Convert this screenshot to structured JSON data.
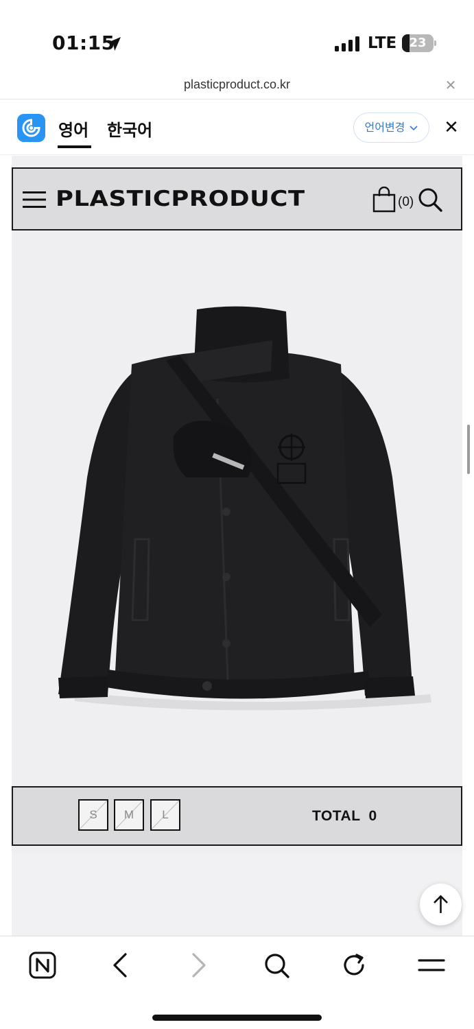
{
  "status_bar": {
    "time": "01:15",
    "network": "LTE",
    "battery_level": "23",
    "battery_fraction": 0.23
  },
  "browser": {
    "url": "plasticproduct.co.kr"
  },
  "translate_bar": {
    "tabs": [
      "영어",
      "한국어"
    ],
    "active_tab": "영어",
    "change_language_label": "언어변경",
    "brand_color": "#2a94f4"
  },
  "site": {
    "logo": "PLASTICPRODUCT",
    "cart_count": "(0)",
    "sizes": [
      "S",
      "M",
      "L"
    ],
    "total_label": "TOTAL",
    "total_value": "0"
  },
  "icons": {
    "status": [
      "location-arrow-icon",
      "signal-bars-icon",
      "battery-icon"
    ],
    "header": [
      "hamburger-menu-icon",
      "shopping-bag-icon",
      "search-icon"
    ],
    "toolbar": [
      "naver-home-icon",
      "back-arrow-icon",
      "forward-arrow-icon",
      "search-icon",
      "refresh-icon",
      "menu-icon"
    ]
  }
}
